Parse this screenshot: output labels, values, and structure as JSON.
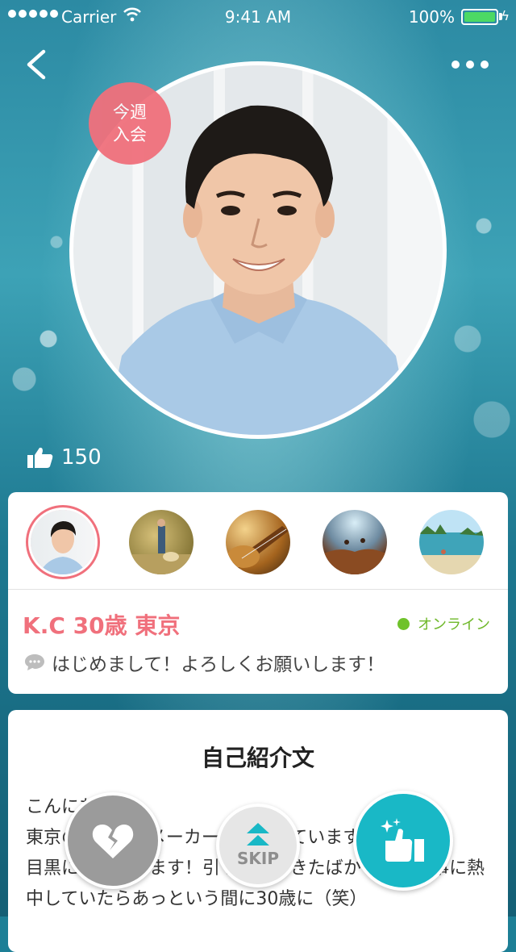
{
  "status_bar": {
    "carrier": "Carrier",
    "time": "9:41 AM",
    "battery": "100%"
  },
  "profile": {
    "badge_line1": "今週",
    "badge_line2": "入会",
    "likes": "150",
    "name_line": "K.C 30歳 東京",
    "online_status": "オンライン",
    "greeting": "はじめまして！よろしくお願いします！"
  },
  "intro": {
    "title": "自己紹介文",
    "text": "こんにちは！\n東京のIT企業でメーカー営業をしています。今は\n目黒に住んでいます！引っ越してきたばかりで、仕事に熱\n中していたらあっという間に30歳に（笑）"
  },
  "actions": {
    "skip_label": "SKIP"
  },
  "colors": {
    "accent_pink": "#f0707c",
    "online_green": "#6fc22b",
    "like_teal": "#19b8c6"
  }
}
